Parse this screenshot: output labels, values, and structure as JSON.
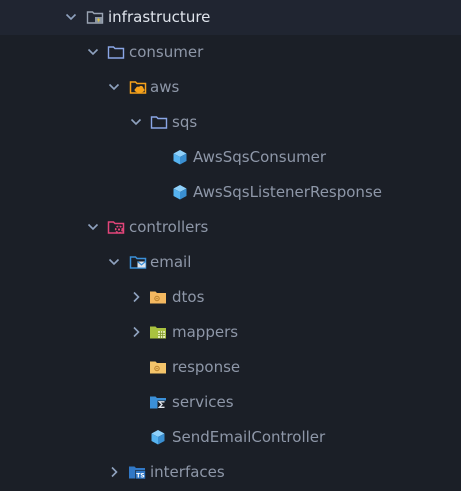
{
  "explorer": {
    "items": [
      {
        "label": "infrastructure",
        "icon": "infrastructure-folder-icon",
        "expanded": true
      },
      {
        "label": "consumer",
        "icon": "folder-icon",
        "expanded": true
      },
      {
        "label": "aws",
        "icon": "aws-folder-icon",
        "expanded": true
      },
      {
        "label": "sqs",
        "icon": "folder-icon",
        "expanded": true
      },
      {
        "label": "AwsSqsConsumer",
        "icon": "class-cube-icon"
      },
      {
        "label": "AwsSqsListenerResponse",
        "icon": "class-cube-icon"
      },
      {
        "label": "controllers",
        "icon": "controllers-folder-icon",
        "expanded": true
      },
      {
        "label": "email",
        "icon": "email-folder-icon",
        "expanded": true
      },
      {
        "label": "dtos",
        "icon": "dtos-folder-icon",
        "expanded": false
      },
      {
        "label": "mappers",
        "icon": "mappers-folder-icon",
        "expanded": false
      },
      {
        "label": "response",
        "icon": "response-folder-icon"
      },
      {
        "label": "services",
        "icon": "services-folder-icon"
      },
      {
        "label": "SendEmailController",
        "icon": "class-cube-icon"
      },
      {
        "label": "interfaces",
        "icon": "typescript-folder-icon",
        "expanded": false
      }
    ]
  },
  "colors": {
    "background": "#1b1f27",
    "text": "#8e97a8",
    "text_selected": "#dfe4ec",
    "chevron": "#8fa2bf",
    "folder_outline": "#8aa6e6",
    "aws_orange": "#f7a21b",
    "class_cube": "#56b3f0",
    "controllers_pink": "#e3457a",
    "mappers_green": "#a9c23f",
    "response_yellow": "#f4c46a",
    "services_blue": "#3b90d9"
  }
}
